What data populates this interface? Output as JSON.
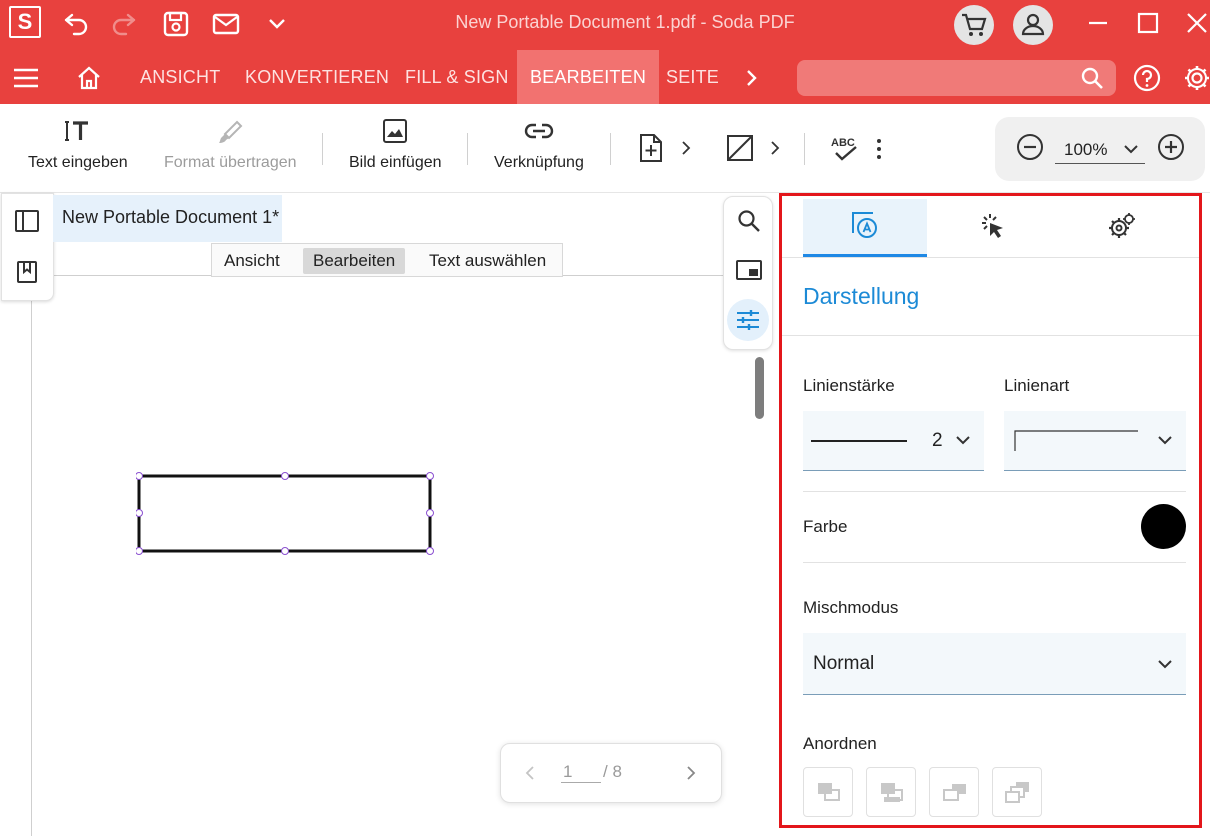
{
  "window": {
    "title": "New Portable Document 1.pdf   -   Soda PDF",
    "logo_letter": "S"
  },
  "menu": {
    "items": [
      "ANSICHT",
      "KONVERTIEREN",
      "FILL & SIGN",
      "BEARBEITEN",
      "SEITE"
    ],
    "active": "BEARBEITEN",
    "search_placeholder": ""
  },
  "toolbar": {
    "text_entry": "Text eingeben",
    "format_transfer": "Format übertragen",
    "insert_image": "Bild einfügen",
    "link": "Verknüpfung",
    "zoom_value": "100%"
  },
  "document": {
    "tab_title": "New Portable Document 1*",
    "modes": [
      "Ansicht",
      "Bearbeiten",
      "Text auswählen"
    ],
    "active_mode": "Bearbeiten",
    "page_current": "1",
    "page_total": "/ 8"
  },
  "panel": {
    "section_title": "Darstellung",
    "line_width_label": "Linienstärke",
    "line_width_value": "2",
    "line_style_label": "Linienart",
    "color_label": "Farbe",
    "color_value": "#000000",
    "blend_mode_label": "Mischmodus",
    "blend_mode_value": "Normal",
    "arrange_label": "Anordnen"
  },
  "colors": {
    "brand": "#e8413e",
    "accent": "#1c8ad6",
    "highlight_border": "#e3161b"
  }
}
